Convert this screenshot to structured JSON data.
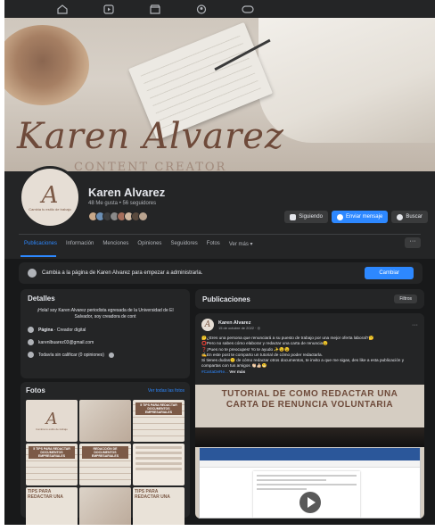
{
  "profile": {
    "name": "Karen Alvarez",
    "stats": "48 Me gusta • 56 seguidores",
    "avatar_monogram": "A",
    "avatar_tagline": "Cambia tu estilo de trabajo",
    "cover_script": "Karen Alvarez",
    "cover_subtitle": "CONTENT CREATOR"
  },
  "actions": {
    "following": "Siguiendo",
    "message": "Enviar mensaje",
    "search": "Buscar"
  },
  "tabs": [
    "Publicaciones",
    "Información",
    "Menciones",
    "Opiniones",
    "Seguidores",
    "Fotos",
    "Ver más ▾"
  ],
  "admin_bar": {
    "text": "Cambia a la página de Karen Alvarez para empezar a administrarla.",
    "button": "Cambiar"
  },
  "details": {
    "title": "Detalles",
    "bio": "¡Hola! soy Karen Alvarez periodista egresada de la Universidad de El Salvador, soy creadora de cont",
    "category_bold": "Página",
    "category": " · Creador digital",
    "email": "karenlbuarez03@gmail.com",
    "rating": "Todavía sin calificar (0 opiniones)"
  },
  "photos": {
    "title": "Fotos",
    "see_all": "Ver todas las fotos",
    "captions": [
      "",
      "",
      "5 TIPS PARA REDACTAR DOCUMENTOS EMPRESARIALES",
      "5 TIPS PARA REDACTAR DOCUMENTOS EMPRESARIALES",
      "REDACCIÓN DE DOCUMENTOS EMPRESARIALES",
      "",
      "TIPS PARA REDACTAR UNA",
      "",
      "TIPS PARA REDACTAR UNA"
    ]
  },
  "posts": {
    "title": "Publicaciones",
    "filter": "Filtros",
    "author": "Karen Alvarez",
    "date": "15 de octubre de 2022 · ◎",
    "lines": [
      "🤔¿Eres una persona que renunciará a su puesto de trabajo por una mejor oferta laboral?🤔",
      "⭕Pero no sabes cómo elaborar y redactar una carta de renuncia😯",
      "❓¡Pues no te preocupes! Yo te ayudo ✨😉😉",
      "✍En este post te comparto un tutorial de cómo poder redactarla.",
      "Si tienes dudas😕 de cómo redactar otros documentos, te invito a que me sigas, des like a esta publicación y compartas con tus amigos 👏🏻👍🏻😁"
    ],
    "hashtag": "#CartaDeRe...",
    "see_more": " Ver más",
    "image_title": "TUTORIAL DE COMO REDACTAR UNA CARTA DE RENUNCIA VOLUNTARIA"
  },
  "colors": {
    "accent": "#2d88ff",
    "card": "#242526",
    "background": "#18191a",
    "brand_brown": "#7c5a47"
  }
}
